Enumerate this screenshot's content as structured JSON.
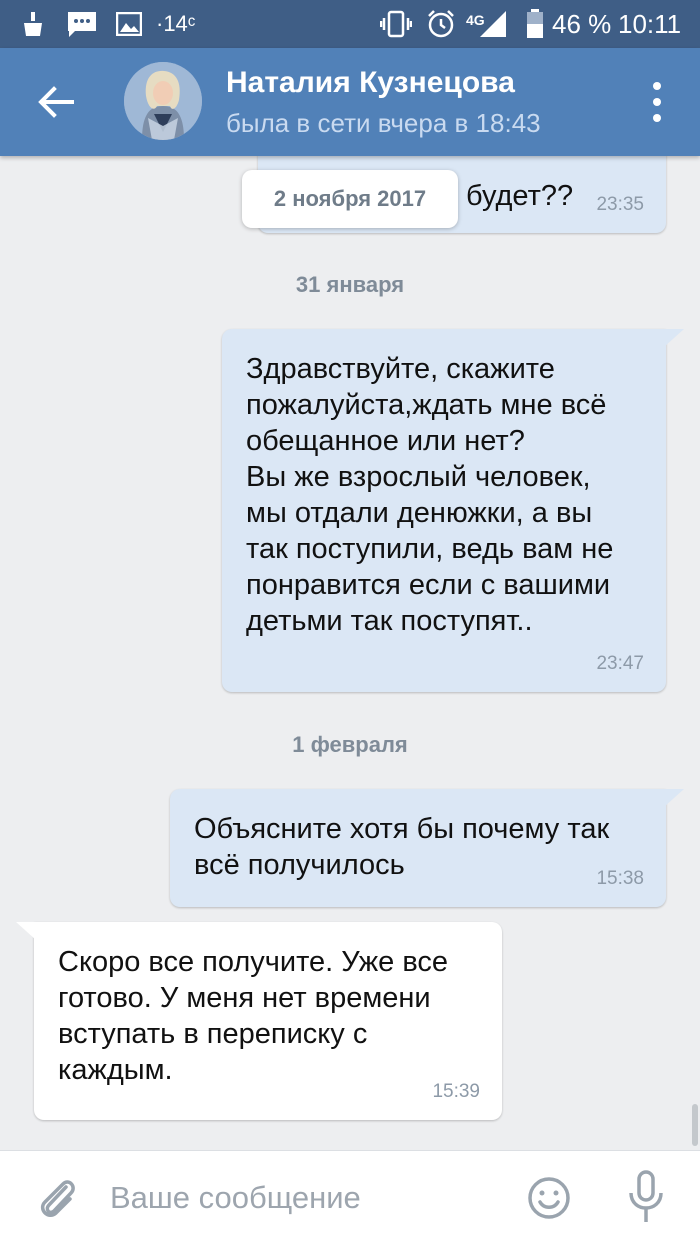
{
  "status_bar": {
    "temperature": "·14ᶜ",
    "network": "4G",
    "battery": "46 %",
    "time": "10:11",
    "icons": [
      "cleaner-icon",
      "message-notification-icon",
      "gallery-icon",
      "vibrate-icon",
      "alarm-icon",
      "signal-icon",
      "battery-icon"
    ]
  },
  "header": {
    "contact_name": "Наталия Кузнецова",
    "contact_status": "была в сети вчера в 18:43"
  },
  "messages": [
    {
      "dir": "out",
      "text": "будет??",
      "time": "23:35"
    },
    {
      "type": "date",
      "text": "31 января"
    },
    {
      "dir": "out",
      "text": "Здравствуйте, скажите\nпожалуйста,ждать мне всё\nобещанное или нет?\nВы же взрослый человек,\nмы отдали денюжки, а вы\nтак поступили, ведь вам не\nпонравится если с вашими\nдетьми так поступят..",
      "time": "23:47"
    },
    {
      "type": "date",
      "text": "1 февраля"
    },
    {
      "dir": "out",
      "text": "Объясните хотя бы почему так\nвсё получилось",
      "time": "15:38"
    },
    {
      "dir": "in",
      "text": "Скоро все получите. Уже все\nготово. У меня нет времени\nвступать в переписку с\nкаждым.",
      "time": "15:39"
    }
  ],
  "floating_date": "2 ноября 2017",
  "composer": {
    "placeholder": "Ваше сообщение"
  },
  "colors": {
    "header": "#5181b8",
    "status_bar": "#3f5e86",
    "background": "#edeef0",
    "outgoing_bubble": "#dbe7f5",
    "incoming_bubble": "#ffffff"
  }
}
